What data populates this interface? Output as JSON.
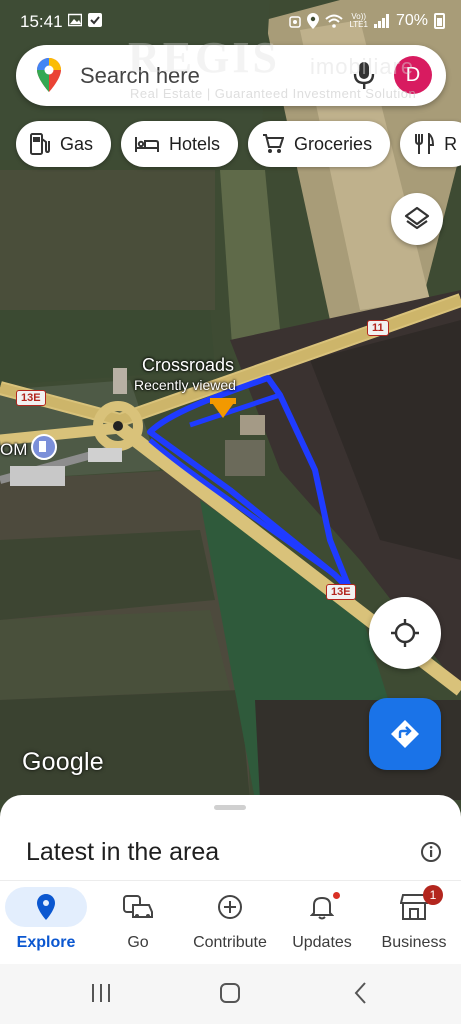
{
  "status_bar": {
    "time": "15:41",
    "lte_top": "Vo))",
    "lte_bottom": "LTE1",
    "battery": "70%"
  },
  "watermark": {
    "brand": "REGIS",
    "sub": "imobiliare",
    "tagline": "Real Estate | Guaranteed Investment Solution"
  },
  "search": {
    "placeholder": "Search here",
    "avatar_letter": "D"
  },
  "chips": [
    {
      "label": "Gas",
      "icon": "gas-station-icon"
    },
    {
      "label": "Hotels",
      "icon": "bed-icon"
    },
    {
      "label": "Groceries",
      "icon": "cart-icon"
    },
    {
      "label": "R",
      "icon": "restaurant-icon"
    }
  ],
  "map": {
    "place_name": "Crossroads",
    "place_sub": "Recently viewed",
    "poi_left": "OM",
    "road_labels": [
      "11",
      "13E",
      "13E"
    ],
    "attribution": "Google"
  },
  "sheet": {
    "title": "Latest in the area"
  },
  "bottom_nav": {
    "items": [
      {
        "label": "Explore",
        "icon": "explore-pin-icon",
        "active": true
      },
      {
        "label": "Go",
        "icon": "commute-icon",
        "active": false
      },
      {
        "label": "Contribute",
        "icon": "add-circle-icon",
        "active": false
      },
      {
        "label": "Updates",
        "icon": "bell-icon",
        "active": false
      },
      {
        "label": "Business",
        "icon": "store-icon",
        "active": false,
        "badge": "1"
      }
    ]
  },
  "colors": {
    "accent": "#1a73e8",
    "active_nav": "#0b57d0",
    "avatar": "#d81b60",
    "annotation": "#1f3bff"
  }
}
